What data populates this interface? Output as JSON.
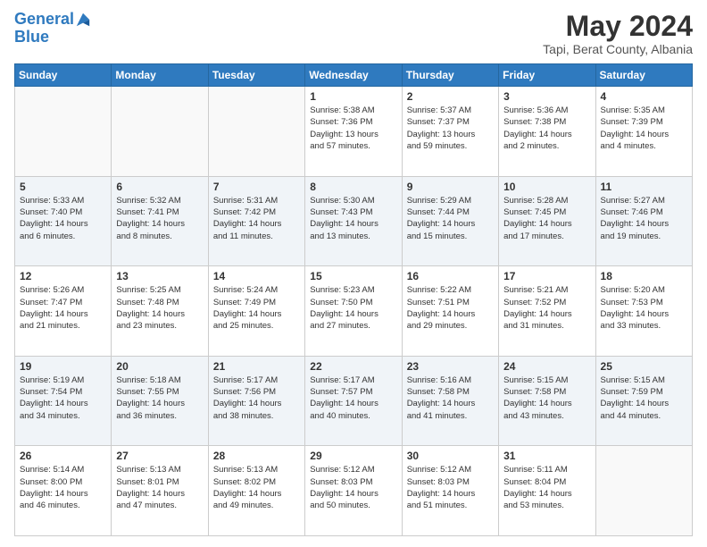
{
  "header": {
    "logo_line1": "General",
    "logo_line2": "Blue",
    "title": "May 2024",
    "subtitle": "Tapi, Berat County, Albania"
  },
  "days_of_week": [
    "Sunday",
    "Monday",
    "Tuesday",
    "Wednesday",
    "Thursday",
    "Friday",
    "Saturday"
  ],
  "weeks": [
    {
      "days": [
        {
          "num": "",
          "info": ""
        },
        {
          "num": "",
          "info": ""
        },
        {
          "num": "",
          "info": ""
        },
        {
          "num": "1",
          "info": "Sunrise: 5:38 AM\nSunset: 7:36 PM\nDaylight: 13 hours\nand 57 minutes."
        },
        {
          "num": "2",
          "info": "Sunrise: 5:37 AM\nSunset: 7:37 PM\nDaylight: 13 hours\nand 59 minutes."
        },
        {
          "num": "3",
          "info": "Sunrise: 5:36 AM\nSunset: 7:38 PM\nDaylight: 14 hours\nand 2 minutes."
        },
        {
          "num": "4",
          "info": "Sunrise: 5:35 AM\nSunset: 7:39 PM\nDaylight: 14 hours\nand 4 minutes."
        }
      ]
    },
    {
      "days": [
        {
          "num": "5",
          "info": "Sunrise: 5:33 AM\nSunset: 7:40 PM\nDaylight: 14 hours\nand 6 minutes."
        },
        {
          "num": "6",
          "info": "Sunrise: 5:32 AM\nSunset: 7:41 PM\nDaylight: 14 hours\nand 8 minutes."
        },
        {
          "num": "7",
          "info": "Sunrise: 5:31 AM\nSunset: 7:42 PM\nDaylight: 14 hours\nand 11 minutes."
        },
        {
          "num": "8",
          "info": "Sunrise: 5:30 AM\nSunset: 7:43 PM\nDaylight: 14 hours\nand 13 minutes."
        },
        {
          "num": "9",
          "info": "Sunrise: 5:29 AM\nSunset: 7:44 PM\nDaylight: 14 hours\nand 15 minutes."
        },
        {
          "num": "10",
          "info": "Sunrise: 5:28 AM\nSunset: 7:45 PM\nDaylight: 14 hours\nand 17 minutes."
        },
        {
          "num": "11",
          "info": "Sunrise: 5:27 AM\nSunset: 7:46 PM\nDaylight: 14 hours\nand 19 minutes."
        }
      ]
    },
    {
      "days": [
        {
          "num": "12",
          "info": "Sunrise: 5:26 AM\nSunset: 7:47 PM\nDaylight: 14 hours\nand 21 minutes."
        },
        {
          "num": "13",
          "info": "Sunrise: 5:25 AM\nSunset: 7:48 PM\nDaylight: 14 hours\nand 23 minutes."
        },
        {
          "num": "14",
          "info": "Sunrise: 5:24 AM\nSunset: 7:49 PM\nDaylight: 14 hours\nand 25 minutes."
        },
        {
          "num": "15",
          "info": "Sunrise: 5:23 AM\nSunset: 7:50 PM\nDaylight: 14 hours\nand 27 minutes."
        },
        {
          "num": "16",
          "info": "Sunrise: 5:22 AM\nSunset: 7:51 PM\nDaylight: 14 hours\nand 29 minutes."
        },
        {
          "num": "17",
          "info": "Sunrise: 5:21 AM\nSunset: 7:52 PM\nDaylight: 14 hours\nand 31 minutes."
        },
        {
          "num": "18",
          "info": "Sunrise: 5:20 AM\nSunset: 7:53 PM\nDaylight: 14 hours\nand 33 minutes."
        }
      ]
    },
    {
      "days": [
        {
          "num": "19",
          "info": "Sunrise: 5:19 AM\nSunset: 7:54 PM\nDaylight: 14 hours\nand 34 minutes."
        },
        {
          "num": "20",
          "info": "Sunrise: 5:18 AM\nSunset: 7:55 PM\nDaylight: 14 hours\nand 36 minutes."
        },
        {
          "num": "21",
          "info": "Sunrise: 5:17 AM\nSunset: 7:56 PM\nDaylight: 14 hours\nand 38 minutes."
        },
        {
          "num": "22",
          "info": "Sunrise: 5:17 AM\nSunset: 7:57 PM\nDaylight: 14 hours\nand 40 minutes."
        },
        {
          "num": "23",
          "info": "Sunrise: 5:16 AM\nSunset: 7:58 PM\nDaylight: 14 hours\nand 41 minutes."
        },
        {
          "num": "24",
          "info": "Sunrise: 5:15 AM\nSunset: 7:58 PM\nDaylight: 14 hours\nand 43 minutes."
        },
        {
          "num": "25",
          "info": "Sunrise: 5:15 AM\nSunset: 7:59 PM\nDaylight: 14 hours\nand 44 minutes."
        }
      ]
    },
    {
      "days": [
        {
          "num": "26",
          "info": "Sunrise: 5:14 AM\nSunset: 8:00 PM\nDaylight: 14 hours\nand 46 minutes."
        },
        {
          "num": "27",
          "info": "Sunrise: 5:13 AM\nSunset: 8:01 PM\nDaylight: 14 hours\nand 47 minutes."
        },
        {
          "num": "28",
          "info": "Sunrise: 5:13 AM\nSunset: 8:02 PM\nDaylight: 14 hours\nand 49 minutes."
        },
        {
          "num": "29",
          "info": "Sunrise: 5:12 AM\nSunset: 8:03 PM\nDaylight: 14 hours\nand 50 minutes."
        },
        {
          "num": "30",
          "info": "Sunrise: 5:12 AM\nSunset: 8:03 PM\nDaylight: 14 hours\nand 51 minutes."
        },
        {
          "num": "31",
          "info": "Sunrise: 5:11 AM\nSunset: 8:04 PM\nDaylight: 14 hours\nand 53 minutes."
        },
        {
          "num": "",
          "info": ""
        }
      ]
    }
  ]
}
